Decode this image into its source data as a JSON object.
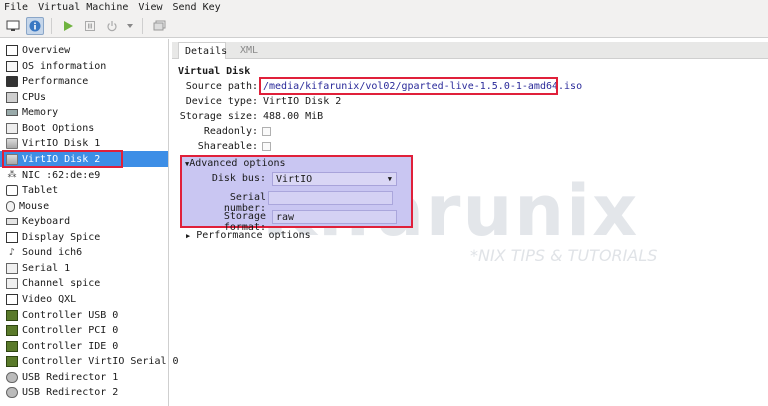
{
  "menu": [
    "File",
    "Virtual Machine",
    "View",
    "Send Key"
  ],
  "toolbar": {
    "icons": [
      "monitor-icon",
      "info-icon",
      "play-icon",
      "pause-icon",
      "power-icon",
      "dropdown-icon",
      "screenshot-icon"
    ]
  },
  "sidebar": {
    "items": [
      {
        "label": "Overview",
        "icon": "overview-icon"
      },
      {
        "label": "OS information",
        "icon": "os-icon"
      },
      {
        "label": "Performance",
        "icon": "performance-icon"
      },
      {
        "label": "CPUs",
        "icon": "cpu-icon"
      },
      {
        "label": "Memory",
        "icon": "memory-icon"
      },
      {
        "label": "Boot Options",
        "icon": "boot-icon"
      },
      {
        "label": "VirtIO Disk 1",
        "icon": "disk-icon"
      },
      {
        "label": "VirtIO Disk 2",
        "icon": "disk-icon"
      },
      {
        "label": "NIC :62:de:e9",
        "icon": "nic-icon"
      },
      {
        "label": "Tablet",
        "icon": "tablet-icon"
      },
      {
        "label": "Mouse",
        "icon": "mouse-icon"
      },
      {
        "label": "Keyboard",
        "icon": "keyboard-icon"
      },
      {
        "label": "Display Spice",
        "icon": "display-icon"
      },
      {
        "label": "Sound ich6",
        "icon": "sound-icon"
      },
      {
        "label": "Serial 1",
        "icon": "serial-icon"
      },
      {
        "label": "Channel spice",
        "icon": "channel-icon"
      },
      {
        "label": "Video QXL",
        "icon": "video-icon"
      },
      {
        "label": "Controller USB 0",
        "icon": "controller-icon"
      },
      {
        "label": "Controller PCI 0",
        "icon": "controller-icon"
      },
      {
        "label": "Controller IDE 0",
        "icon": "controller-icon"
      },
      {
        "label": "Controller VirtIO Serial 0",
        "icon": "controller-icon"
      },
      {
        "label": "USB Redirector 1",
        "icon": "usb-redirector-icon"
      },
      {
        "label": "USB Redirector 2",
        "icon": "usb-redirector-icon"
      }
    ],
    "selected_index": 7
  },
  "tabs": [
    {
      "label": "Details",
      "active": true
    },
    {
      "label": "XML",
      "active": false
    }
  ],
  "details": {
    "section_title": "Virtual Disk",
    "source_path_label": "Source path:",
    "source_path": "/media/kifarunix/vol02/gparted-live-1.5.0-1-amd64.iso",
    "device_type_label": "Device type:",
    "device_type": "VirtIO Disk 2",
    "storage_size_label": "Storage size:",
    "storage_size": "488.00 MiB",
    "readonly_label": "Readonly:",
    "readonly": false,
    "shareable_label": "Shareable:",
    "shareable": false
  },
  "advanced": {
    "title": "Advanced options",
    "expanded": true,
    "disk_bus_label": "Disk bus:",
    "disk_bus": "VirtIO",
    "serial_number_label": "Serial number:",
    "serial_number": "",
    "storage_format_label": "Storage format:",
    "storage_format": "raw"
  },
  "performance": {
    "title": "Performance options",
    "expanded": false
  },
  "watermark": {
    "brand": "Kifarunix",
    "tagline": "*NIX TIPS & TUTORIALS"
  },
  "colors": {
    "selection": "#3d8ee6",
    "highlight_box": "#e0203a",
    "advanced_panel": "#c9c6f2"
  }
}
